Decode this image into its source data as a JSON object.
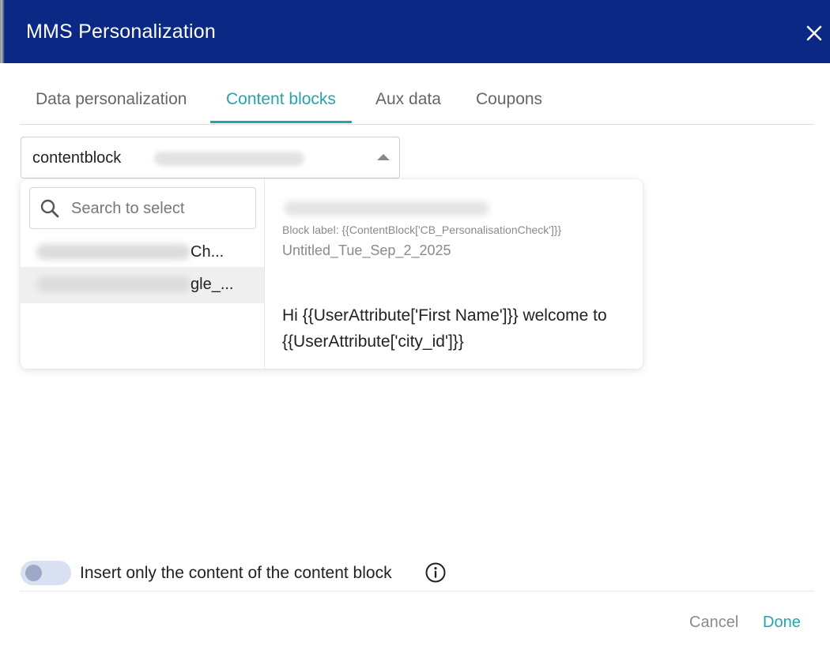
{
  "dialog": {
    "title": "MMS Personalization"
  },
  "tabs": [
    {
      "label": "Data personalization"
    },
    {
      "label": "Content blocks"
    },
    {
      "label": "Aux data"
    },
    {
      "label": "Coupons"
    }
  ],
  "select": {
    "value": "contentblock"
  },
  "dropdown": {
    "search_placeholder": "Search to select",
    "items": [
      {
        "visible_text": "Ch..."
      },
      {
        "visible_text": "gle_..."
      }
    ]
  },
  "preview": {
    "block_label": "Block label: {{ContentBlock['CB_PersonalisationCheck']}}",
    "untitled": "Untitled_Tue_Sep_2_2025",
    "body": "Hi {{UserAttribute['First Name']}} welcome to {{UserAttribute['city_id']}}"
  },
  "toggle": {
    "label": "Insert only the content of the content block",
    "checked": false
  },
  "footer": {
    "cancel": "Cancel",
    "done": "Done"
  },
  "colors": {
    "header": "#0b2885",
    "accent": "#26a4a9"
  },
  "icons": [
    "close-icon",
    "caret-up-icon",
    "search-icon",
    "info-icon"
  ]
}
